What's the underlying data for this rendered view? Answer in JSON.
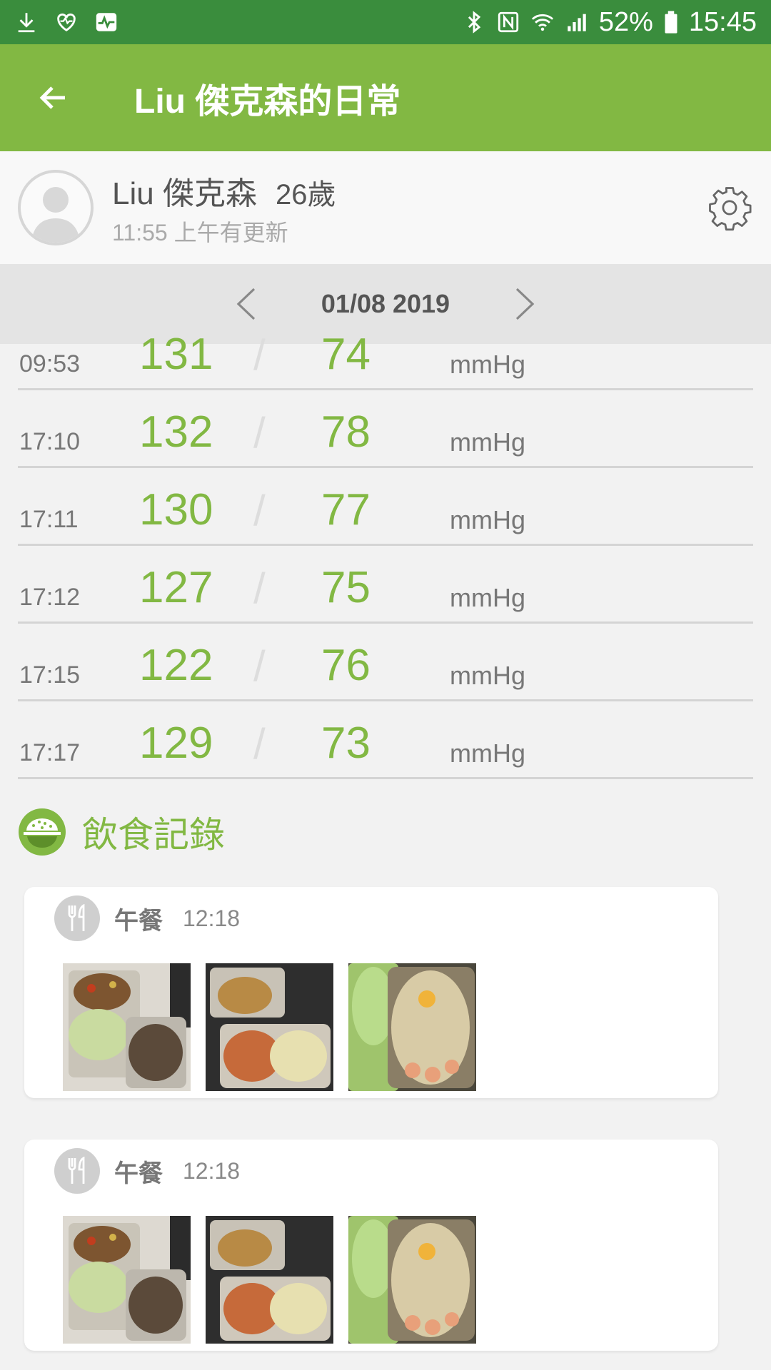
{
  "status_bar": {
    "battery_text": "52%",
    "time": "15:45",
    "left_icons": [
      "download-icon",
      "heart-icon",
      "activity-icon"
    ],
    "right_icons": [
      "bluetooth-icon",
      "nfc-icon",
      "wifi-icon",
      "signal-icon",
      "battery-icon"
    ]
  },
  "app_bar": {
    "title": "Liu 傑克森的日常"
  },
  "profile": {
    "name": "Liu 傑克森",
    "age": "26歲",
    "update_text": "11:55 上午有更新"
  },
  "date_nav": {
    "date": "01/08 2019"
  },
  "readings": [
    {
      "time": "09:53",
      "systolic": "131",
      "diastolic": "74",
      "unit": "mmHg"
    },
    {
      "time": "17:10",
      "systolic": "132",
      "diastolic": "78",
      "unit": "mmHg"
    },
    {
      "time": "17:11",
      "systolic": "130",
      "diastolic": "77",
      "unit": "mmHg"
    },
    {
      "time": "17:12",
      "systolic": "127",
      "diastolic": "75",
      "unit": "mmHg"
    },
    {
      "time": "17:15",
      "systolic": "122",
      "diastolic": "76",
      "unit": "mmHg"
    },
    {
      "time": "17:17",
      "systolic": "129",
      "diastolic": "73",
      "unit": "mmHg"
    }
  ],
  "slash": "/",
  "diet": {
    "title": "飲食記錄",
    "meals": [
      {
        "type": "午餐",
        "time": "12:18"
      },
      {
        "type": "午餐",
        "time": "12:18"
      }
    ]
  },
  "colors": {
    "status_bar": "#3a8d3d",
    "app_bar": "#82b843",
    "accent": "#82b843"
  }
}
